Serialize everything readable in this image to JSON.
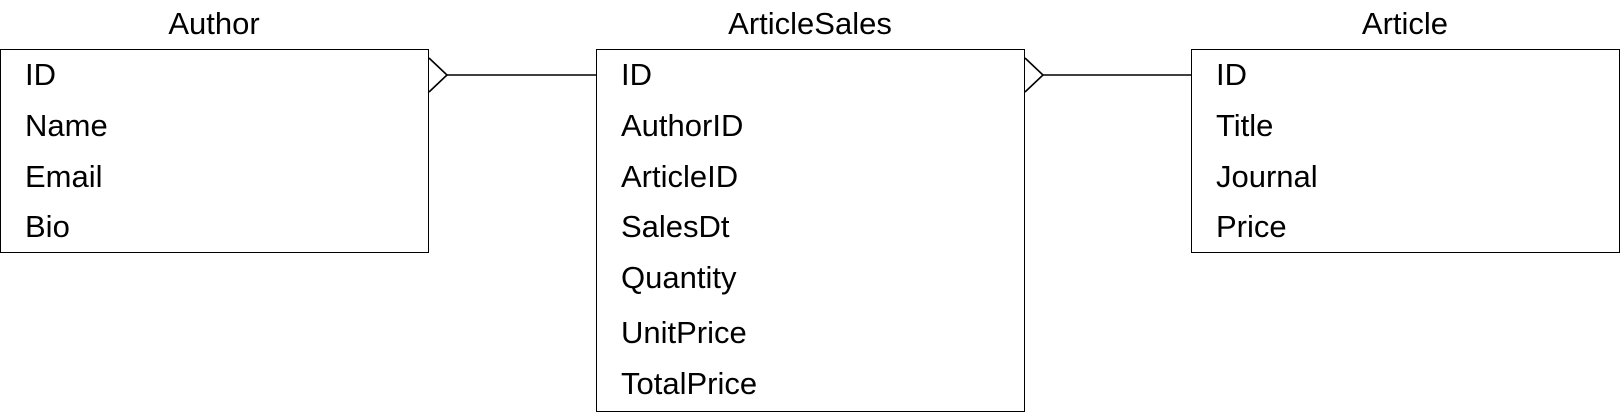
{
  "entities": {
    "author": {
      "title": "Author",
      "fields": [
        "ID",
        "Name",
        "Email",
        "Bio"
      ]
    },
    "article_sales": {
      "title": "ArticleSales",
      "fields": [
        "ID",
        "AuthorID",
        "ArticleID",
        "SalesDt",
        "Quantity",
        "UnitPrice",
        "TotalPrice"
      ]
    },
    "article": {
      "title": "Article",
      "fields": [
        "ID",
        "Title",
        "Journal",
        "Price"
      ]
    }
  },
  "relationships": [
    {
      "from": "author",
      "to": "article_sales",
      "from_cardinality": "many",
      "to_cardinality": "one"
    },
    {
      "from": "article_sales",
      "to": "article",
      "from_cardinality": "many",
      "to_cardinality": "one"
    }
  ],
  "colors": {
    "stroke": "#000000",
    "background": "#ffffff",
    "text": "#000000"
  }
}
